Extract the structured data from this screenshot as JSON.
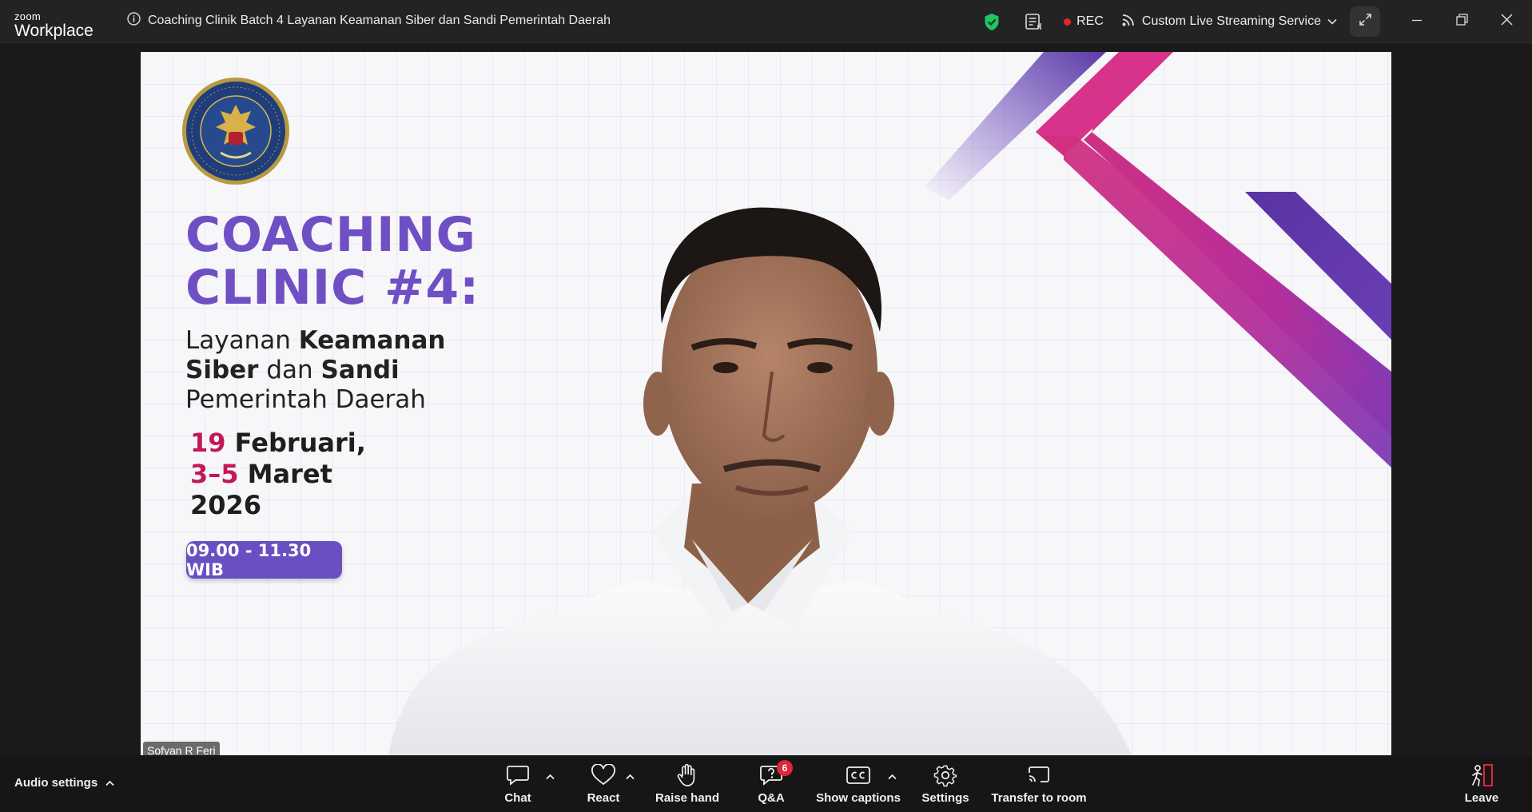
{
  "app": {
    "logo_small": "zoom",
    "logo_big": "Workplace"
  },
  "meeting": {
    "title": "Coaching Clinik Batch 4 Layanan Keamanan Siber dan Sandi Pemerintah Daerah"
  },
  "top_bar": {
    "rec_label": "REC",
    "stream_label": "Custom Live Streaming Service",
    "security_color": "#22c55e",
    "rec_color": "#e6252b"
  },
  "video": {
    "participant_name": "Sofyan R Feri",
    "background": {
      "headline_line1": "COACHING",
      "headline_line2": "CLINIC #4:",
      "sub_l1_plain": "Layanan ",
      "sub_l1_bold": "Keamanan",
      "sub_l2_bold1": "Siber",
      "sub_l2_plain": " dan ",
      "sub_l2_bold2": "Sandi",
      "sub_l3": "Pemerintah Daerah",
      "date1_num": "19",
      "date1_text": " Februari,",
      "date2_num": "3–5",
      "date2_text": " Maret",
      "year": "2026",
      "time": "09.00 - 11.30 WIB",
      "seal_text": "BADAN SIBER DAN SANDI NEGARA • REPUBLIK INDONESIA",
      "accent_purple": "#6f4fc4",
      "accent_pink": "#c1185a"
    }
  },
  "toolbar": {
    "audio_settings": "Audio settings",
    "chat": "Chat",
    "react": "React",
    "raise_hand": "Raise hand",
    "qa": "Q&A",
    "qa_badge": "6",
    "show_captions": "Show captions",
    "settings": "Settings",
    "transfer": "Transfer to room",
    "leave": "Leave"
  }
}
